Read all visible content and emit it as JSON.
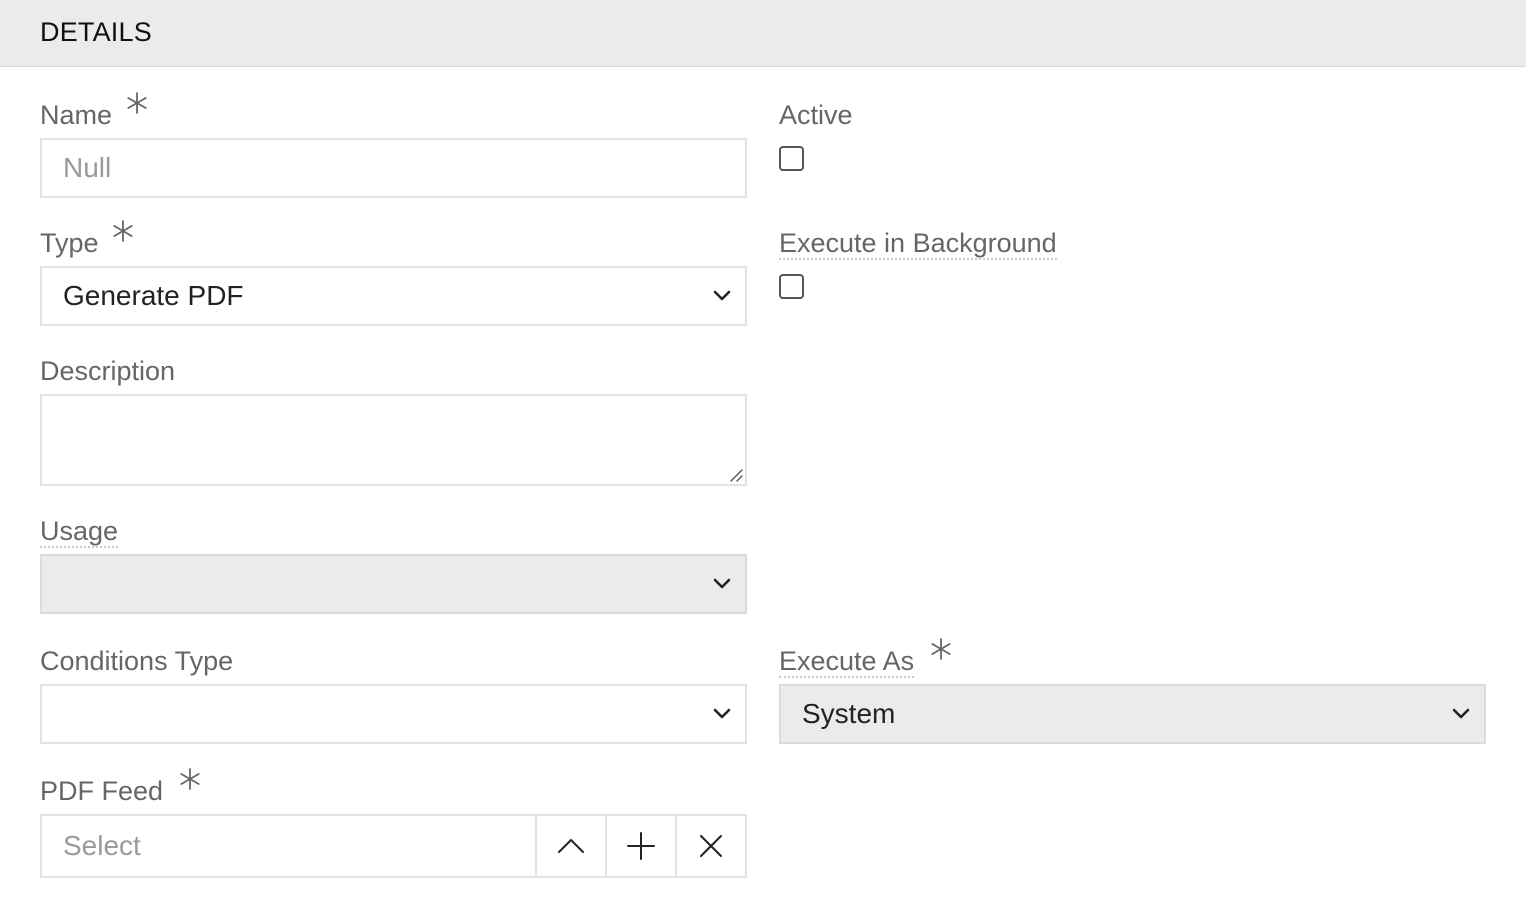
{
  "header": {
    "title": "DETAILS"
  },
  "name": {
    "label": "Name",
    "required": true,
    "placeholder": "Null",
    "value": ""
  },
  "active": {
    "label": "Active",
    "checked": false
  },
  "type": {
    "label": "Type",
    "required": true,
    "selected": "Generate PDF"
  },
  "execute_in_background": {
    "label": "Execute in Background",
    "checked": false
  },
  "description": {
    "label": "Description",
    "value": ""
  },
  "usage": {
    "label": "Usage",
    "selected": ""
  },
  "conditions_type": {
    "label": "Conditions Type",
    "selected": ""
  },
  "execute_as": {
    "label": "Execute As",
    "required": true,
    "selected": "System"
  },
  "pdf_feed": {
    "label": "PDF Feed",
    "required": true,
    "placeholder": "Select"
  },
  "icons": {
    "required": "asterisk-icon",
    "select": "chevron-down-icon",
    "expand": "chevron-up-icon",
    "add": "plus-icon",
    "clear": "close-icon",
    "resize": "resize-grip-icon"
  }
}
